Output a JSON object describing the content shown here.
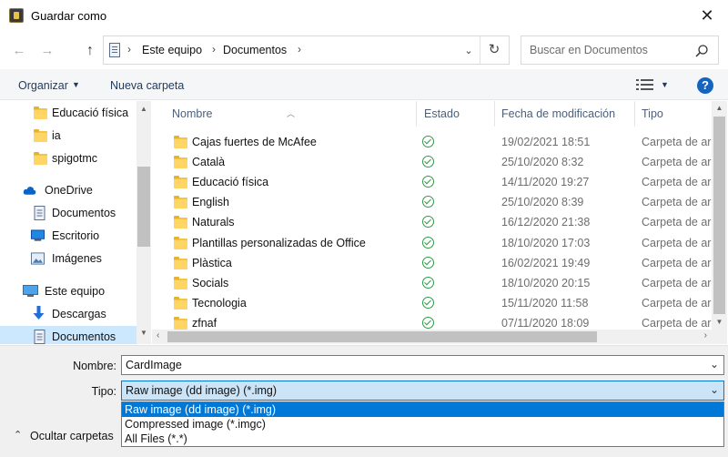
{
  "window": {
    "title": "Guardar como",
    "close_icon": "close-icon"
  },
  "navigation": {
    "back_icon": "arrow-left-icon",
    "forward_icon": "arrow-right-icon",
    "up_icon": "arrow-up-icon",
    "breadcrumb": [
      "Este equipo",
      "Documentos"
    ],
    "refresh_icon": "refresh-icon",
    "search_placeholder": "Buscar en Documentos"
  },
  "toolbar": {
    "organize_label": "Organizar",
    "new_folder_label": "Nueva carpeta",
    "view_icon": "details-view-icon",
    "help_label": "?"
  },
  "sidebar": {
    "items": [
      {
        "label": "Educació física",
        "icon": "folder-icon"
      },
      {
        "label": "ia",
        "icon": "folder-icon"
      },
      {
        "label": "spigotmc",
        "icon": "folder-icon"
      },
      {
        "label": "OneDrive",
        "icon": "cloud-icon"
      },
      {
        "label": "Documentos",
        "icon": "document-icon"
      },
      {
        "label": "Escritorio",
        "icon": "desktop-icon"
      },
      {
        "label": "Imágenes",
        "icon": "pictures-icon"
      },
      {
        "label": "Este equipo",
        "icon": "computer-icon"
      },
      {
        "label": "Descargas",
        "icon": "download-icon"
      },
      {
        "label": "Documentos",
        "icon": "document-icon",
        "selected": true
      }
    ]
  },
  "file_list": {
    "columns": [
      "Nombre",
      "Estado",
      "Fecha de modificación",
      "Tipo"
    ],
    "rows": [
      {
        "name": "Cajas fuertes de McAfee",
        "date": "19/02/2021 18:51",
        "type": "Carpeta de arc"
      },
      {
        "name": "Català",
        "date": "25/10/2020 8:32",
        "type": "Carpeta de arc"
      },
      {
        "name": "Educació física",
        "date": "14/11/2020 19:27",
        "type": "Carpeta de arc"
      },
      {
        "name": "English",
        "date": "25/10/2020 8:39",
        "type": "Carpeta de arc"
      },
      {
        "name": "Naturals",
        "date": "16/12/2020 21:38",
        "type": "Carpeta de arc"
      },
      {
        "name": "Plantillas personalizadas de Office",
        "date": "18/10/2020 17:03",
        "type": "Carpeta de arc"
      },
      {
        "name": "Plàstica",
        "date": "16/02/2021 19:49",
        "type": "Carpeta de arc"
      },
      {
        "name": "Socials",
        "date": "18/10/2020 20:15",
        "type": "Carpeta de arc"
      },
      {
        "name": "Tecnologia",
        "date": "15/11/2020 11:58",
        "type": "Carpeta de arc"
      },
      {
        "name": "zfnaf",
        "date": "07/11/2020 18:09",
        "type": "Carpeta de arc"
      }
    ]
  },
  "form": {
    "name_label": "Nombre:",
    "name_value": "CardImage",
    "type_label": "Tipo:",
    "type_value": "Raw image (dd image) (*.img)",
    "type_options": [
      "Raw image (dd image) (*.img)",
      "Compressed image (*.imgc)",
      "All Files (*.*)"
    ],
    "hide_folders_label": "Ocultar carpetas"
  },
  "colors": {
    "accent": "#0078d7",
    "selection": "#cce8ff",
    "folder": "#ffd666",
    "status_ok": "#2e9a47"
  }
}
